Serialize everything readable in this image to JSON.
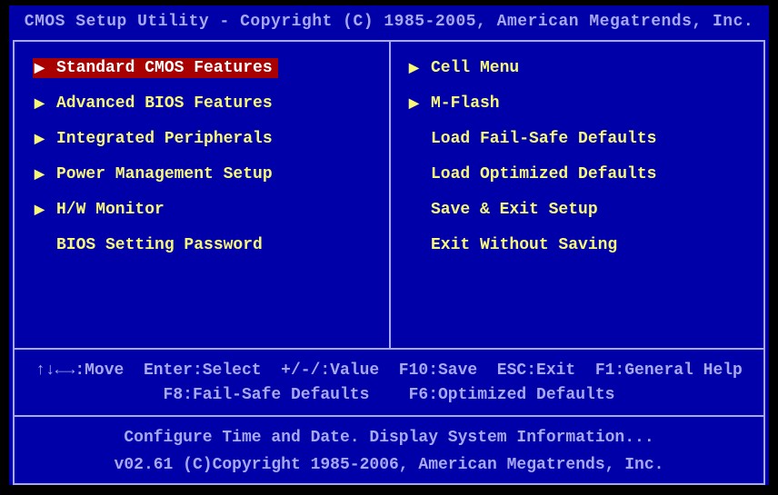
{
  "header": "CMOS Setup Utility - Copyright (C) 1985-2005, American Megatrends, Inc.",
  "leftMenu": [
    {
      "label": "Standard CMOS Features",
      "hasArrow": true,
      "selected": true
    },
    {
      "label": "Advanced BIOS Features",
      "hasArrow": true,
      "selected": false
    },
    {
      "label": "Integrated Peripherals",
      "hasArrow": true,
      "selected": false
    },
    {
      "label": "Power Management Setup",
      "hasArrow": true,
      "selected": false
    },
    {
      "label": "H/W Monitor",
      "hasArrow": true,
      "selected": false
    },
    {
      "label": "BIOS Setting Password",
      "hasArrow": false,
      "selected": false
    }
  ],
  "rightMenu": [
    {
      "label": "Cell Menu",
      "hasArrow": true,
      "selected": false
    },
    {
      "label": "M-Flash",
      "hasArrow": true,
      "selected": false
    },
    {
      "label": "Load Fail-Safe Defaults",
      "hasArrow": false,
      "selected": false
    },
    {
      "label": "Load Optimized Defaults",
      "hasArrow": false,
      "selected": false
    },
    {
      "label": "Save & Exit Setup",
      "hasArrow": false,
      "selected": false
    },
    {
      "label": "Exit Without Saving",
      "hasArrow": false,
      "selected": false
    }
  ],
  "help": {
    "line1": "↑↓←→:Move  Enter:Select  +/-/:Value  F10:Save  ESC:Exit  F1:General Help",
    "line2": "F8:Fail-Safe Defaults    F6:Optimized Defaults"
  },
  "footer": {
    "line1": "Configure Time and Date.  Display System Information...",
    "line2": "v02.61 (C)Copyright 1985-2006, American Megatrends, Inc."
  }
}
